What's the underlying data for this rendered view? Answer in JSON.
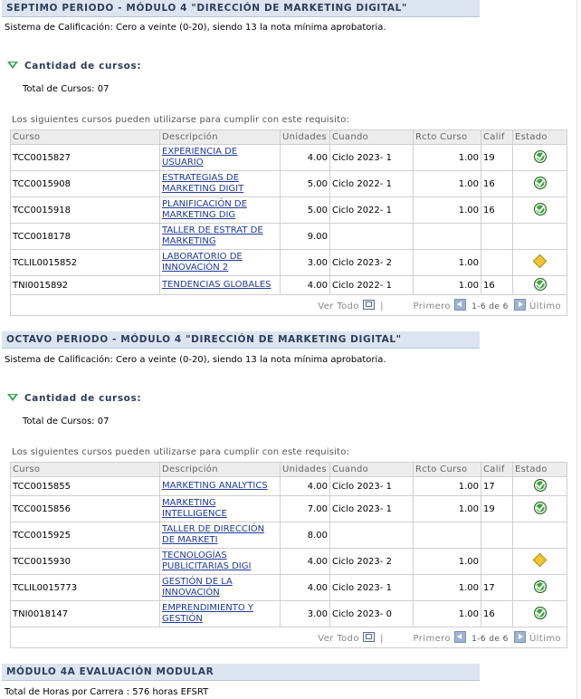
{
  "sections": [
    {
      "title": "SEPTIMO PERIODO - MÓDULO 4 \"DIRECCIÓN DE MARKETING DIGITAL\"",
      "grading": "Sistema de Calificación: Cero a veinte (0-20), siendo 13 la nota mínima aprobatoria.",
      "qty_label": "Cantidad de cursos:",
      "total": "Total de Cursos: 07",
      "req_text": "Los siguientes cursos pueden utilizarse para cumplir con este requisito:",
      "rows": [
        {
          "curso": "TCC0015827",
          "desc1": "EXPERIENCIA DE",
          "desc2": "USUARIO",
          "unidades": "4.00",
          "cuando": "Ciclo 2023- 1",
          "rcto": "1.00",
          "calif": "19",
          "estado": "ok"
        },
        {
          "curso": "TCC0015908",
          "desc1": "ESTRATEGIAS DE",
          "desc2": "MARKETING DIGIT",
          "unidades": "5.00",
          "cuando": "Ciclo 2022- 1",
          "rcto": "1.00",
          "calif": "16",
          "estado": "ok"
        },
        {
          "curso": "TCC0015918",
          "desc1": "PLANIFICACIÓN DE",
          "desc2": "MARKETING DIG",
          "unidades": "5.00",
          "cuando": "Ciclo 2022- 1",
          "rcto": "1.00",
          "calif": "16",
          "estado": "ok"
        },
        {
          "curso": "TCC0018178",
          "desc1": "TALLER DE ESTRAT DE",
          "desc2": "MARKETING",
          "unidades": "9.00",
          "cuando": "",
          "rcto": "",
          "calif": "",
          "estado": ""
        },
        {
          "curso": "TCLIL0015852",
          "desc1": "LABORATORIO DE",
          "desc2": "INNOVACIÓN 2",
          "unidades": "3.00",
          "cuando": "Ciclo 2023- 2",
          "rcto": "1.00",
          "calif": "",
          "estado": "warn"
        },
        {
          "curso": "TNI0015892",
          "desc1": "TENDENCIAS GLOBALES",
          "desc2": "",
          "unidades": "4.00",
          "cuando": "Ciclo 2022- 1",
          "rcto": "1.00",
          "calif": "16",
          "estado": "ok"
        }
      ]
    },
    {
      "title": "OCTAVO PERIODO - MÓDULO 4 \"DIRECCIÓN DE MARKETING DIGITAL\"",
      "grading": "Sistema de Calificación: Cero a veinte (0-20), siendo 13 la nota mínima aprobatoria.",
      "qty_label": "Cantidad de cursos:",
      "total": "Total de Cursos: 07",
      "req_text": "Los siguientes cursos pueden utilizarse para cumplir con este requisito:",
      "rows": [
        {
          "curso": "TCC0015855",
          "desc1": "MARKETING ANALYTICS",
          "desc2": "",
          "unidades": "4.00",
          "cuando": "Ciclo 2023- 1",
          "rcto": "1.00",
          "calif": "17",
          "estado": "ok"
        },
        {
          "curso": "TCC0015856",
          "desc1": "MARKETING",
          "desc2": "INTELLIGENCE",
          "unidades": "7.00",
          "cuando": "Ciclo 2023- 1",
          "rcto": "1.00",
          "calif": "19",
          "estado": "ok"
        },
        {
          "curso": "TCC0015925",
          "desc1": "TALLER DE DIRECCIÓN",
          "desc2": "DE MARKETI",
          "unidades": "8.00",
          "cuando": "",
          "rcto": "",
          "calif": "",
          "estado": ""
        },
        {
          "curso": "TCC0015930",
          "desc1": "TECNOLOGÍAS",
          "desc2": "PUBLICITARIAS DIGI",
          "unidades": "4.00",
          "cuando": "Ciclo 2023- 2",
          "rcto": "1.00",
          "calif": "",
          "estado": "warn"
        },
        {
          "curso": "TCLIL0015773",
          "desc1": "GESTIÓN DE LA",
          "desc2": "INNOVACIÓN",
          "unidades": "4.00",
          "cuando": "Ciclo 2023- 1",
          "rcto": "1.00",
          "calif": "17",
          "estado": "ok"
        },
        {
          "curso": "TNI0018147",
          "desc1": "EMPRENDIMIENTO Y",
          "desc2": "GESTIÓN",
          "unidades": "3.00",
          "cuando": "Ciclo 2023- 0",
          "rcto": "1.00",
          "calif": "16",
          "estado": "ok"
        }
      ]
    }
  ],
  "columns": [
    "Curso",
    "Descripción",
    "Unidades",
    "Cuando",
    "Rcto Curso",
    "Calif",
    "Estado"
  ],
  "footer": {
    "view_all": "Ver Todo",
    "sep": "|",
    "first": "Primero",
    "range": "1-6 de 6",
    "last": "Último"
  },
  "icons": {
    "ok": "green-check-circle-icon",
    "warn": "yellow-diamond-warning-icon",
    "zoom": "zoom-grid-icon"
  },
  "colors": {
    "header_bg": "#dce4ef",
    "header_text": "#2d3d5a",
    "link": "#1f3a98",
    "ok": "#3da33a",
    "warn": "#f3c530"
  },
  "modular": {
    "title": "MÓDULO 4A EVALUACIÓN MODULAR",
    "hours": "Total de Horas por Carrera : 576 horas EFSRT"
  }
}
